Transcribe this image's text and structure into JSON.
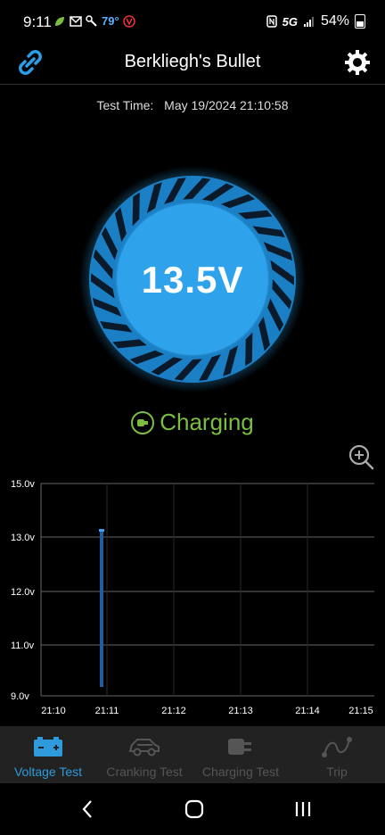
{
  "status_bar": {
    "time": "9:11",
    "temperature": "79°",
    "network": "5G",
    "battery": "54%",
    "icons": [
      "leaf-icon",
      "mail-icon",
      "wrench-icon",
      "v-badge-icon",
      "nfc-icon",
      "signal-icon",
      "battery-icon"
    ]
  },
  "header": {
    "title": "Berkliegh's Bullet",
    "left_icon": "link-icon",
    "right_icon": "gear-icon"
  },
  "test_time": {
    "label": "Test Time:",
    "value": "May 19/2024 21:10:58"
  },
  "gauge": {
    "value": "13.5V",
    "color": "#2a9fe8"
  },
  "status": {
    "text": "Charging",
    "color": "#7bbd3f"
  },
  "zoom_icon": "zoom-in-icon",
  "chart_data": {
    "type": "line",
    "ylabel": "",
    "xlabel": "",
    "y_ticks": [
      "15.0v",
      "13.0v",
      "12.0v",
      "11.0v",
      "9.0v"
    ],
    "x_ticks": [
      "21:10",
      "21:11",
      "21:12",
      "21:13",
      "21:14",
      "21:15"
    ],
    "series": [
      {
        "x": [
          "21:10:58",
          "21:10:58"
        ],
        "y": [
          9.0,
          13.3
        ]
      }
    ],
    "grid": true
  },
  "bottom_nav": {
    "items": [
      {
        "label": "Voltage Test",
        "icon": "battery-icon",
        "active": true
      },
      {
        "label": "Cranking Test",
        "icon": "car-icon",
        "active": false
      },
      {
        "label": "Charging Test",
        "icon": "plug-icon",
        "active": false
      },
      {
        "label": "Trip",
        "icon": "route-icon",
        "active": false
      }
    ]
  }
}
